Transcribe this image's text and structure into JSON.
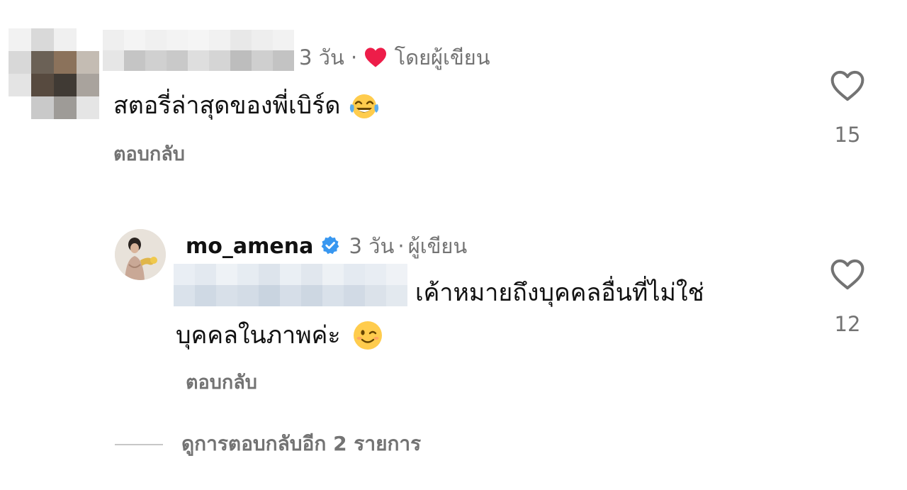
{
  "comments": [
    {
      "time": "3 วัน",
      "separator": "·",
      "author_badge": "โดยผู้เขียน",
      "text": "สตอรี่ล่าสุดของพี่เบิร์ด",
      "emoji": "face-with-tears-of-joy",
      "reply_label": "ตอบกลับ",
      "likes": "15",
      "heart_color": "#ed1d49"
    },
    {
      "username": "mo_amena",
      "verified": true,
      "time": "3 วัน",
      "separator": "·",
      "author_label": "ผู้เขียน",
      "text_line1": "เค้าหมายถึงบุคคลอื่นที่ไม่ใช่",
      "text_line2": "บุคคลในภาพค่ะ",
      "emoji": "winking-face",
      "reply_label": "ตอบกลับ",
      "likes": "12"
    }
  ],
  "view_replies": "ดูการตอบกลับอีก 2 รายการ",
  "colors": {
    "text": "#111111",
    "secondary": "#737373",
    "verified": "#3897f0",
    "heart_red": "#ed1d49"
  }
}
